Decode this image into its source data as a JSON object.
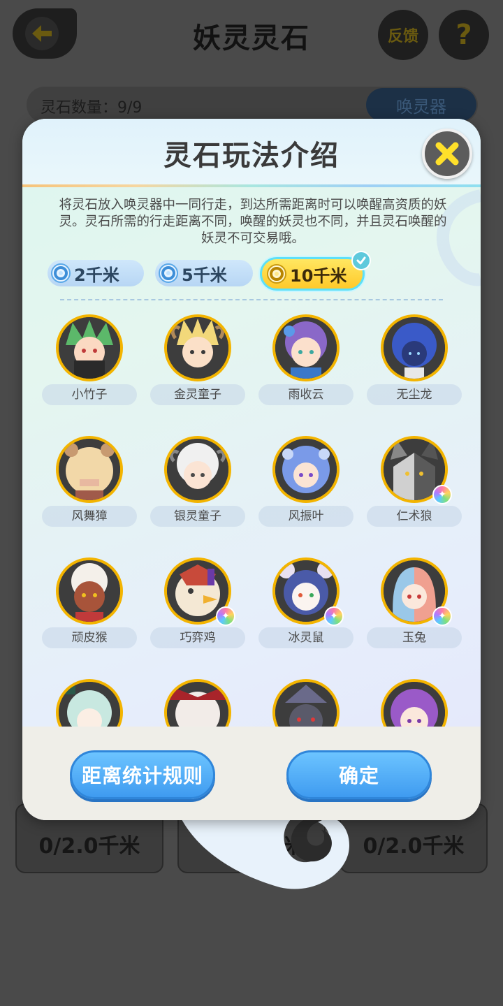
{
  "background": {
    "title": "妖灵灵石",
    "feedback_label": "反馈",
    "help_label": "?",
    "stone_count": "灵石数量：9/9",
    "summon_label": "唤灵器",
    "card_distances": [
      "0/2.0千米",
      "千米",
      "0/2.0千米"
    ]
  },
  "modal": {
    "title": "灵石玩法介绍",
    "description": "将灵石放入唤灵器中一同行走，到达所需距离时可以唤醒高资质的妖灵。灵石所需的行走距离不同，唤醒的妖灵也不同，并且灵石唤醒的妖灵不可交易哦。",
    "tabs": [
      {
        "label": "2千米",
        "selected": false
      },
      {
        "label": "5千米",
        "selected": false
      },
      {
        "label": "10千米",
        "selected": true
      }
    ],
    "characters": [
      {
        "name": "小竹子",
        "rare": false
      },
      {
        "name": "金灵童子",
        "rare": false
      },
      {
        "name": "雨收云",
        "rare": false
      },
      {
        "name": "无尘龙",
        "rare": false
      },
      {
        "name": "风舞獐",
        "rare": false
      },
      {
        "name": "银灵童子",
        "rare": false
      },
      {
        "name": "风振叶",
        "rare": false
      },
      {
        "name": "仁术狼",
        "rare": true
      },
      {
        "name": "顽皮猴",
        "rare": false
      },
      {
        "name": "巧弈鸡",
        "rare": true
      },
      {
        "name": "冰灵鼠",
        "rare": true
      },
      {
        "name": "玉兔",
        "rare": true
      }
    ],
    "footer": {
      "rules_button": "距离统计规则",
      "confirm_button": "确定"
    }
  },
  "colors": {
    "accent_gold": "#f3b400",
    "button_blue": "#3f9bf0",
    "tab_selected": "#ffd435"
  }
}
